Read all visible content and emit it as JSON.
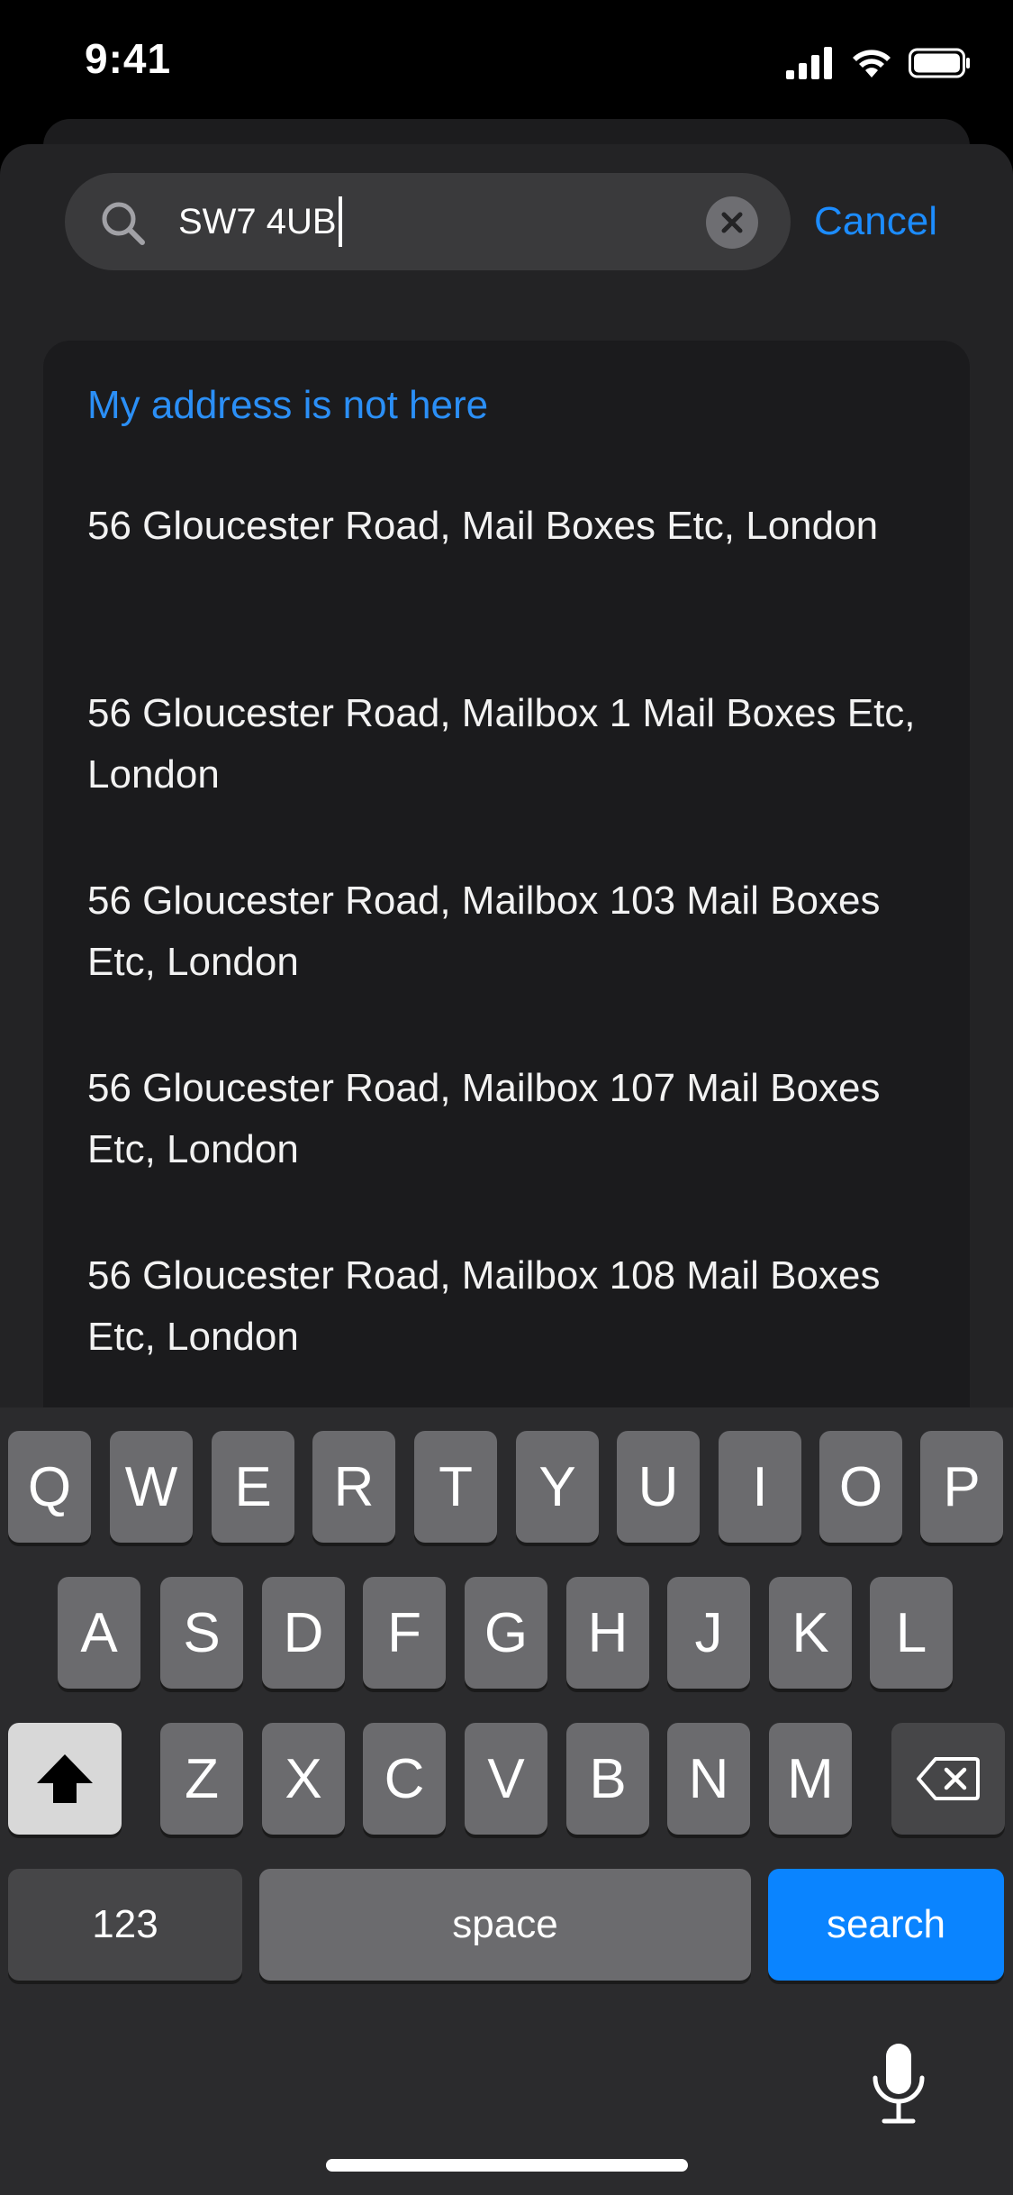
{
  "status_bar": {
    "time": "9:41"
  },
  "search": {
    "value": "SW7 4UB",
    "cancel_label": "Cancel"
  },
  "results": {
    "not_here_label": "My address is not here",
    "items": [
      "56 Gloucester Road, Mail Boxes Etc, London",
      "56 Gloucester Road, Mailbox 1 Mail Boxes Etc, London",
      "56 Gloucester Road, Mailbox 103 Mail Boxes Etc, London",
      "56 Gloucester Road, Mailbox 107 Mail Boxes Etc, London",
      "56 Gloucester Road, Mailbox 108 Mail Boxes Etc, London"
    ]
  },
  "keyboard": {
    "row1": [
      "Q",
      "W",
      "E",
      "R",
      "T",
      "Y",
      "U",
      "I",
      "O",
      "P"
    ],
    "row2": [
      "A",
      "S",
      "D",
      "F",
      "G",
      "H",
      "J",
      "K",
      "L"
    ],
    "row3": [
      "Z",
      "X",
      "C",
      "V",
      "B",
      "N",
      "M"
    ],
    "numbers_label": "123",
    "space_label": "space",
    "search_label": "search"
  },
  "colors": {
    "accent": "#0a84ff",
    "link": "#2b8ff6",
    "background": "#000000"
  },
  "icons": {
    "search": "search-icon",
    "clear": "clear-icon",
    "shift": "shift-icon",
    "delete": "delete-icon",
    "mic": "mic-icon",
    "signal": "signal-icon",
    "wifi": "wifi-icon",
    "battery": "battery-icon"
  }
}
